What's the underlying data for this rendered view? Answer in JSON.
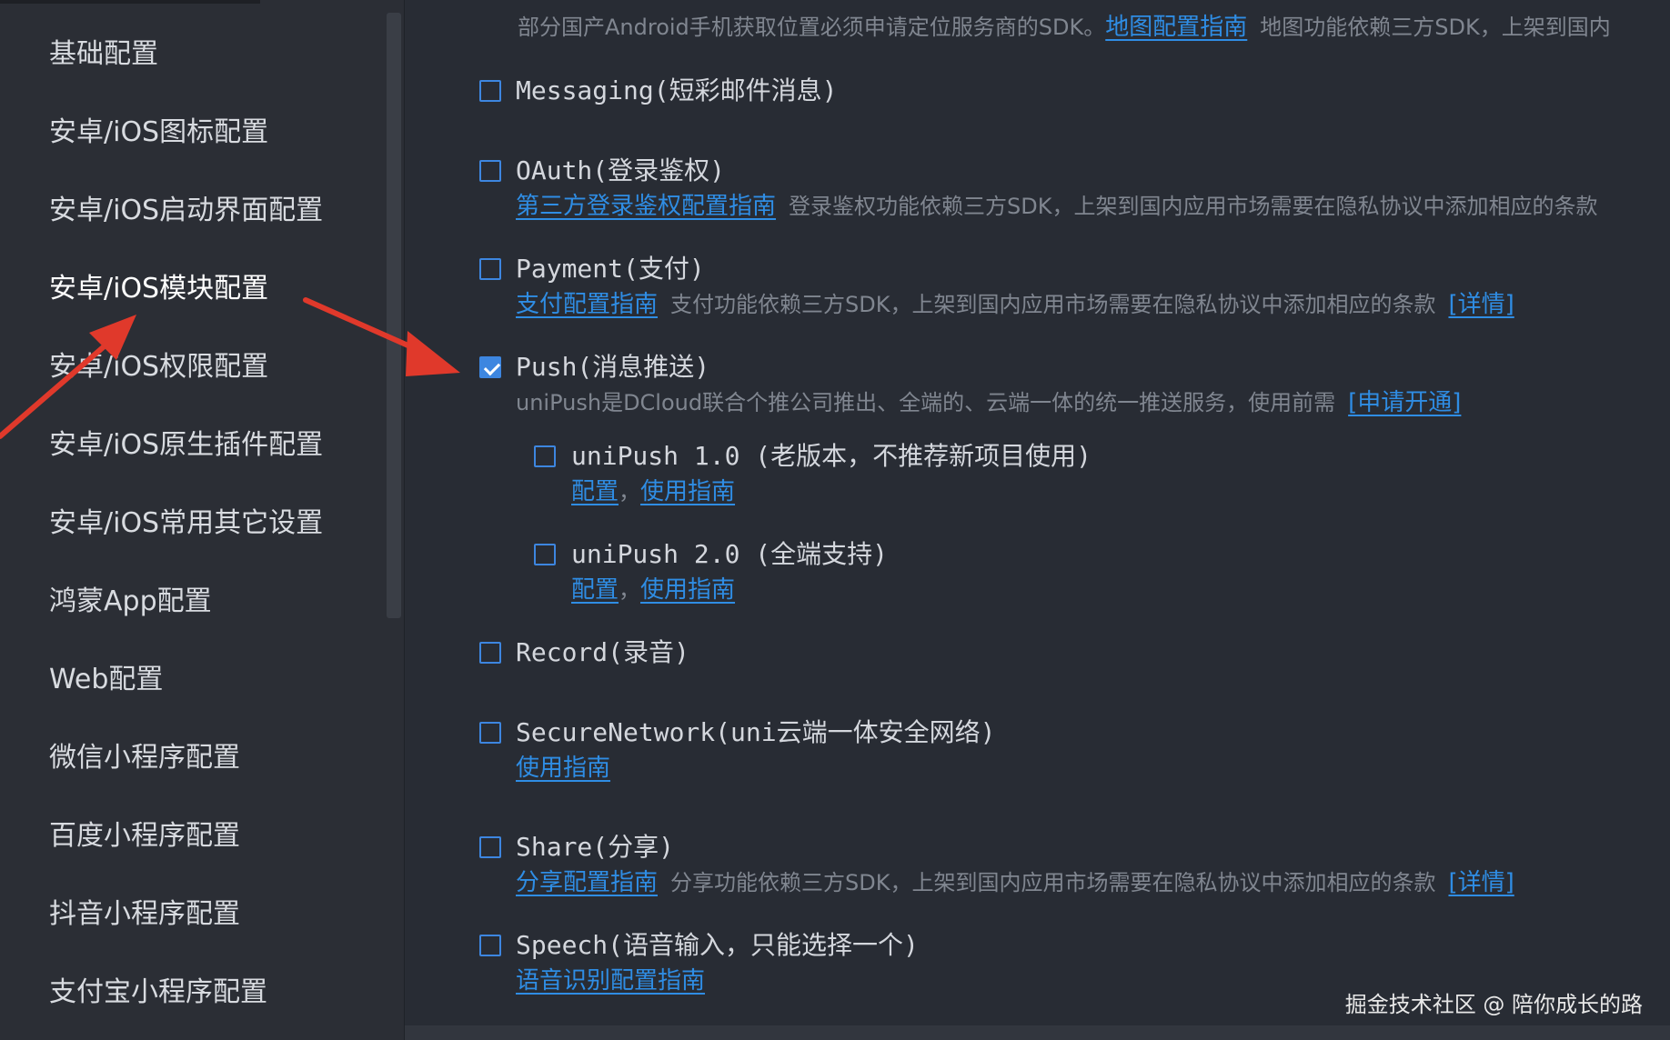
{
  "sidebar": {
    "items": [
      {
        "label": "基础配置"
      },
      {
        "label": "安卓/iOS图标配置"
      },
      {
        "label": "安卓/iOS启动界面配置"
      },
      {
        "label": "安卓/iOS模块配置"
      },
      {
        "label": "安卓/iOS权限配置"
      },
      {
        "label": "安卓/iOS原生插件配置"
      },
      {
        "label": "安卓/iOS常用其它设置"
      },
      {
        "label": "鸿蒙App配置"
      },
      {
        "label": "Web配置"
      },
      {
        "label": "微信小程序配置"
      },
      {
        "label": "百度小程序配置"
      },
      {
        "label": "抖音小程序配置"
      },
      {
        "label": "支付宝小程序配置"
      }
    ],
    "active_index": 3
  },
  "main": {
    "top_note": {
      "text_before": "部分国产Android手机获取位置必须申请定位服务商的SDK。",
      "link": "地图配置指南",
      "text_after": "地图功能依赖三方SDK，上架到国内"
    },
    "modules": {
      "messaging": {
        "label": "Messaging(短彩邮件消息)",
        "checked": false
      },
      "oauth": {
        "label": "OAuth(登录鉴权)",
        "checked": false,
        "link": "第三方登录鉴权配置指南",
        "desc": "登录鉴权功能依赖三方SDK，上架到国内应用市场需要在隐私协议中添加相应的条款"
      },
      "payment": {
        "label": "Payment(支付)",
        "checked": false,
        "link": "支付配置指南",
        "desc": "支付功能依赖三方SDK，上架到国内应用市场需要在隐私协议中添加相应的条款",
        "detail": "[详情]"
      },
      "push": {
        "label": "Push(消息推送)",
        "checked": true,
        "desc": "uniPush是DCloud联合个推公司推出、全端的、云端一体的统一推送服务，使用前需",
        "apply": "[申请开通]"
      },
      "unipush1": {
        "label": "uniPush 1.0 (老版本，不推荐新项目使用)",
        "checked": false,
        "config": "配置",
        "sep": "，",
        "guide": "使用指南"
      },
      "unipush2": {
        "label": "uniPush 2.0 (全端支持)",
        "checked": false,
        "config": "配置",
        "sep": "，",
        "guide": "使用指南"
      },
      "record": {
        "label": "Record(录音)",
        "checked": false
      },
      "securenetwork": {
        "label": "SecureNetwork(uni云端一体安全网络)",
        "checked": false,
        "link": "使用指南"
      },
      "share": {
        "label": "Share(分享)",
        "checked": false,
        "link": "分享配置指南",
        "desc": "分享功能依赖三方SDK，上架到国内应用市场需要在隐私协议中添加相应的条款",
        "detail": "[详情]"
      },
      "speech": {
        "label": "Speech(语音输入，只能选择一个)",
        "checked": false,
        "link": "语音识别配置指南"
      }
    }
  },
  "watermark": "掘金技术社区 @ 陪你成长的路",
  "colors": {
    "accent": "#3d86e0",
    "link": "#2f8de4",
    "annotation": "#e0392b"
  }
}
